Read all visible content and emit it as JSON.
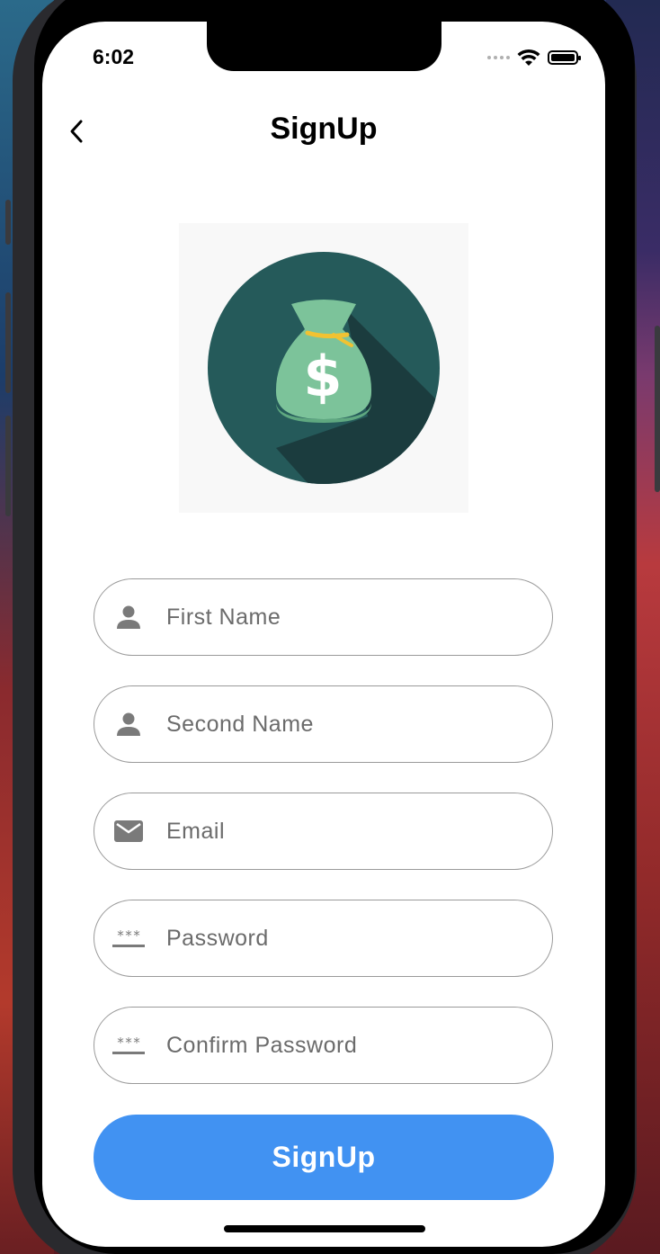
{
  "status_bar": {
    "time": "6:02"
  },
  "nav": {
    "title": "SignUp"
  },
  "form": {
    "first_name_placeholder": "First Name",
    "second_name_placeholder": "Second Name",
    "email_placeholder": "Email",
    "password_placeholder": "Password",
    "confirm_password_placeholder": "Confirm Password",
    "password_icon_glyph": "***",
    "submit_label": "SignUp"
  },
  "icons": {
    "back": "chevron-left-icon",
    "person": "person-icon",
    "email": "mail-icon",
    "password": "password-icon",
    "logo": "money-bag-icon",
    "currency_symbol": "$"
  },
  "colors": {
    "primary_button": "#4192f2",
    "logo_circle": "#255a5a",
    "logo_bag": "#7cc39a",
    "logo_tie": "#f1c232",
    "field_border": "#9a9a9a",
    "icon_gray": "#7a7a7a"
  }
}
